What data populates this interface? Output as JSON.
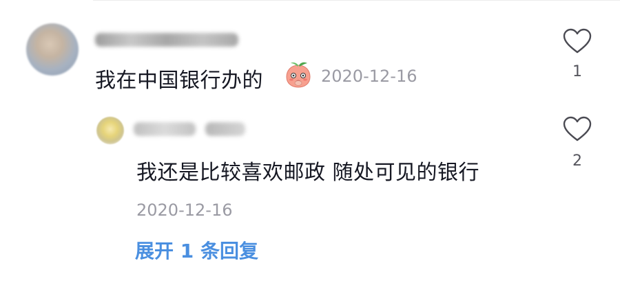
{
  "comment": {
    "text": "我在中国银行办的",
    "date": "2020-12-16",
    "likes": "1",
    "emoji_icon": "peach-face-icon"
  },
  "reply": {
    "text": "我还是比较喜欢邮政  随处可见的银行",
    "date": "2020-12-16",
    "likes": "2"
  },
  "expand_replies": "展开 1 条回复",
  "colors": {
    "text": "#161823",
    "meta": "#9a9aa3",
    "link": "#4a8fe0"
  }
}
